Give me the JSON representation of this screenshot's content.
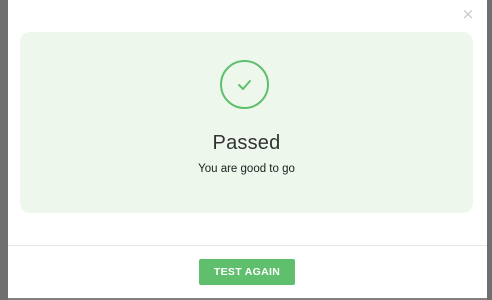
{
  "modal": {
    "close_glyph": "×",
    "status_title": "Passed",
    "status_message": "You are good to go",
    "status_icon": "checkmark-icon",
    "action_button_label": "TEST AGAIN"
  },
  "colors": {
    "success_green": "#5fbf6c",
    "panel_background": "#edf7ec",
    "backdrop": "#808080"
  }
}
